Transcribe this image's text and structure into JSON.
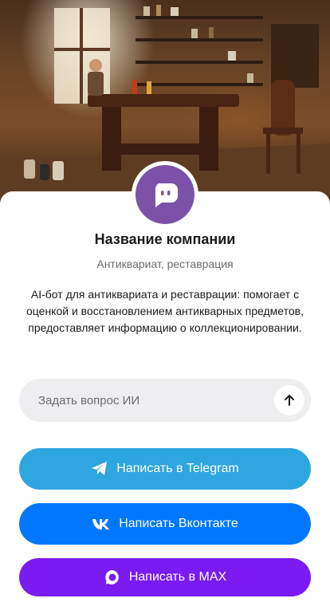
{
  "hero": {
    "icon": "workshop-photo"
  },
  "profile": {
    "avatar_icon": "chat-bot-icon",
    "avatar_color": "#7b52a8",
    "company_name": "Название компании",
    "category": "Антиквариат, реставрация",
    "description": "AI-бот для антиквариата и реставрации: помогает с оценкой и восстановлением антикварных предметов, предоставляет информацию о коллекционировании."
  },
  "ask": {
    "placeholder": "Задать вопрос ИИ",
    "value": "",
    "send_icon": "arrow-up-icon"
  },
  "actions": {
    "telegram": {
      "label": "Написать в Telegram",
      "color": "#2ea6e0",
      "icon": "telegram-icon"
    },
    "vk": {
      "label": "Написать Вконтакте",
      "color": "#0077ff",
      "icon": "vk-icon"
    },
    "max": {
      "label": "Написать в MAX",
      "color": "#7a1bf2",
      "icon": "max-icon"
    }
  }
}
